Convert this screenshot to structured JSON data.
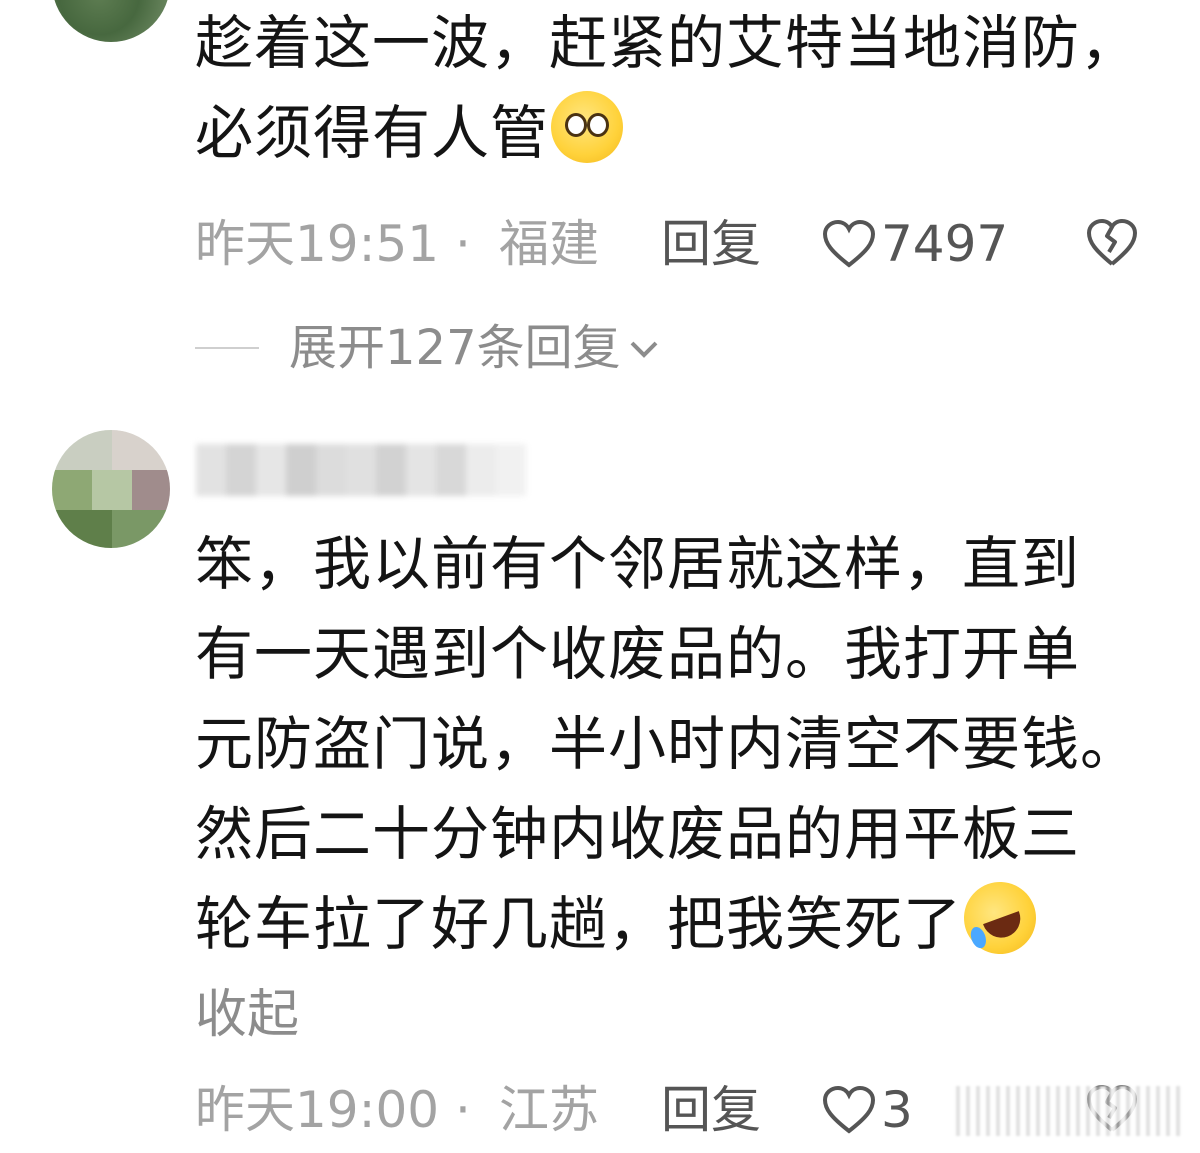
{
  "comments": [
    {
      "text_lines": [
        "趁着这一波，赶紧的艾特当地消防，",
        "必须得有人管"
      ],
      "emoji": "pleading-face-icon",
      "time": "昨天19:51",
      "separator": "·",
      "location": "福建",
      "reply_label": "回复",
      "like_count": "7497",
      "expand_label": "展开127条回复"
    },
    {
      "text_lines": [
        "笨，我以前有个邻居就这样，直到",
        "有一天遇到个收废品的。我打开单",
        "元防盗门说，半小时内清空不要钱。",
        "然后二十分钟内收废品的用平板三",
        "轮车拉了好几趟，把我笑死了"
      ],
      "emoji": "rolling-on-floor-laughing-icon",
      "collapse_label": "收起",
      "time": "昨天19:00",
      "separator": "·",
      "location": "江苏",
      "reply_label": "回复",
      "like_count": "3"
    }
  ],
  "colors": {
    "text": "#141414",
    "meta": "#a3a3a3",
    "action": "#555555"
  }
}
